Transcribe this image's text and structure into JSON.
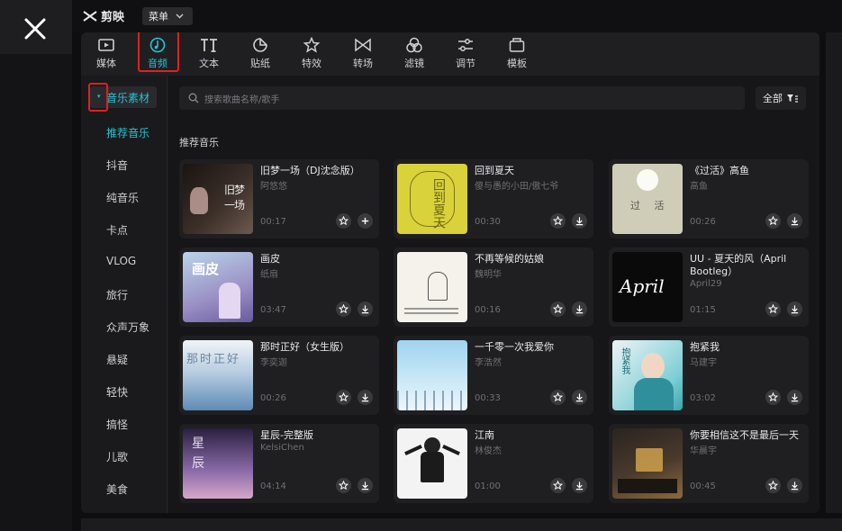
{
  "app": {
    "logo_text": "剪映",
    "menu_label": "菜单"
  },
  "toolbar": {
    "tabs": [
      {
        "label": "媒体",
        "icon": "media-icon"
      },
      {
        "label": "音频",
        "icon": "audio-icon",
        "active": true
      },
      {
        "label": "文本",
        "icon": "text-icon"
      },
      {
        "label": "贴纸",
        "icon": "sticker-icon"
      },
      {
        "label": "特效",
        "icon": "effects-icon"
      },
      {
        "label": "转场",
        "icon": "transition-icon"
      },
      {
        "label": "滤镜",
        "icon": "filter-icon"
      },
      {
        "label": "调节",
        "icon": "adjust-icon"
      },
      {
        "label": "模板",
        "icon": "template-icon"
      }
    ]
  },
  "sidebar": {
    "header": "音乐素材",
    "items": [
      {
        "label": "推荐音乐",
        "active": true
      },
      {
        "label": "抖音"
      },
      {
        "label": "纯音乐"
      },
      {
        "label": "卡点"
      },
      {
        "label": "VLOG"
      },
      {
        "label": "旅行"
      },
      {
        "label": "众声万象"
      },
      {
        "label": "悬疑"
      },
      {
        "label": "轻快"
      },
      {
        "label": "搞怪"
      },
      {
        "label": "儿歌"
      },
      {
        "label": "美食"
      }
    ]
  },
  "search": {
    "placeholder": "搜索歌曲名称/歌手",
    "filter_label": "全部"
  },
  "section_title": "推荐音乐",
  "songs": [
    {
      "title": "旧梦一场（DJ沈念版）",
      "artist": "阿悠悠",
      "duration": "00:17",
      "action": "add",
      "thumb_text": "旧梦一场"
    },
    {
      "title": "回到夏天",
      "artist": "傻与愚的小田/傲七爷",
      "duration": "00:30",
      "action": "download",
      "thumb_text": "回到夏天"
    },
    {
      "title": "《过活》高鱼",
      "artist": "高鱼",
      "duration": "00:26",
      "action": "download",
      "thumb_text": "过 活"
    },
    {
      "title": "画皮",
      "artist": "纸扇",
      "duration": "03:47",
      "action": "download",
      "thumb_text": "画皮"
    },
    {
      "title": "不再等候的姑娘",
      "artist": "魏明华",
      "duration": "00:16",
      "action": "download",
      "thumb_text": ""
    },
    {
      "title": "UU - 夏天的风（April Bootleg）",
      "artist": "April29",
      "duration": "01:15",
      "action": "download",
      "thumb_text": "April"
    },
    {
      "title": "那时正好（女生版）",
      "artist": "李奕迦",
      "duration": "00:26",
      "action": "download",
      "thumb_text": "那时正好"
    },
    {
      "title": "一千零一次我爱你",
      "artist": "李浩然",
      "duration": "00:33",
      "action": "download",
      "thumb_text": ""
    },
    {
      "title": "抱紧我",
      "artist": "马建宇",
      "duration": "03:02",
      "action": "download",
      "thumb_text": "抱紧我"
    },
    {
      "title": "星辰-完整版",
      "artist": "KelsiChen",
      "duration": "04:14",
      "action": "download",
      "thumb_text": "星辰"
    },
    {
      "title": "江南",
      "artist": "林俊杰",
      "duration": "01:00",
      "action": "download",
      "thumb_text": ""
    },
    {
      "title": "你要相信这不是最后一天",
      "artist": "华晨宇",
      "duration": "00:45",
      "action": "download",
      "thumb_text": ""
    }
  ],
  "colors": {
    "accent": "#27c3d3",
    "highlight_box": "#e02020"
  }
}
